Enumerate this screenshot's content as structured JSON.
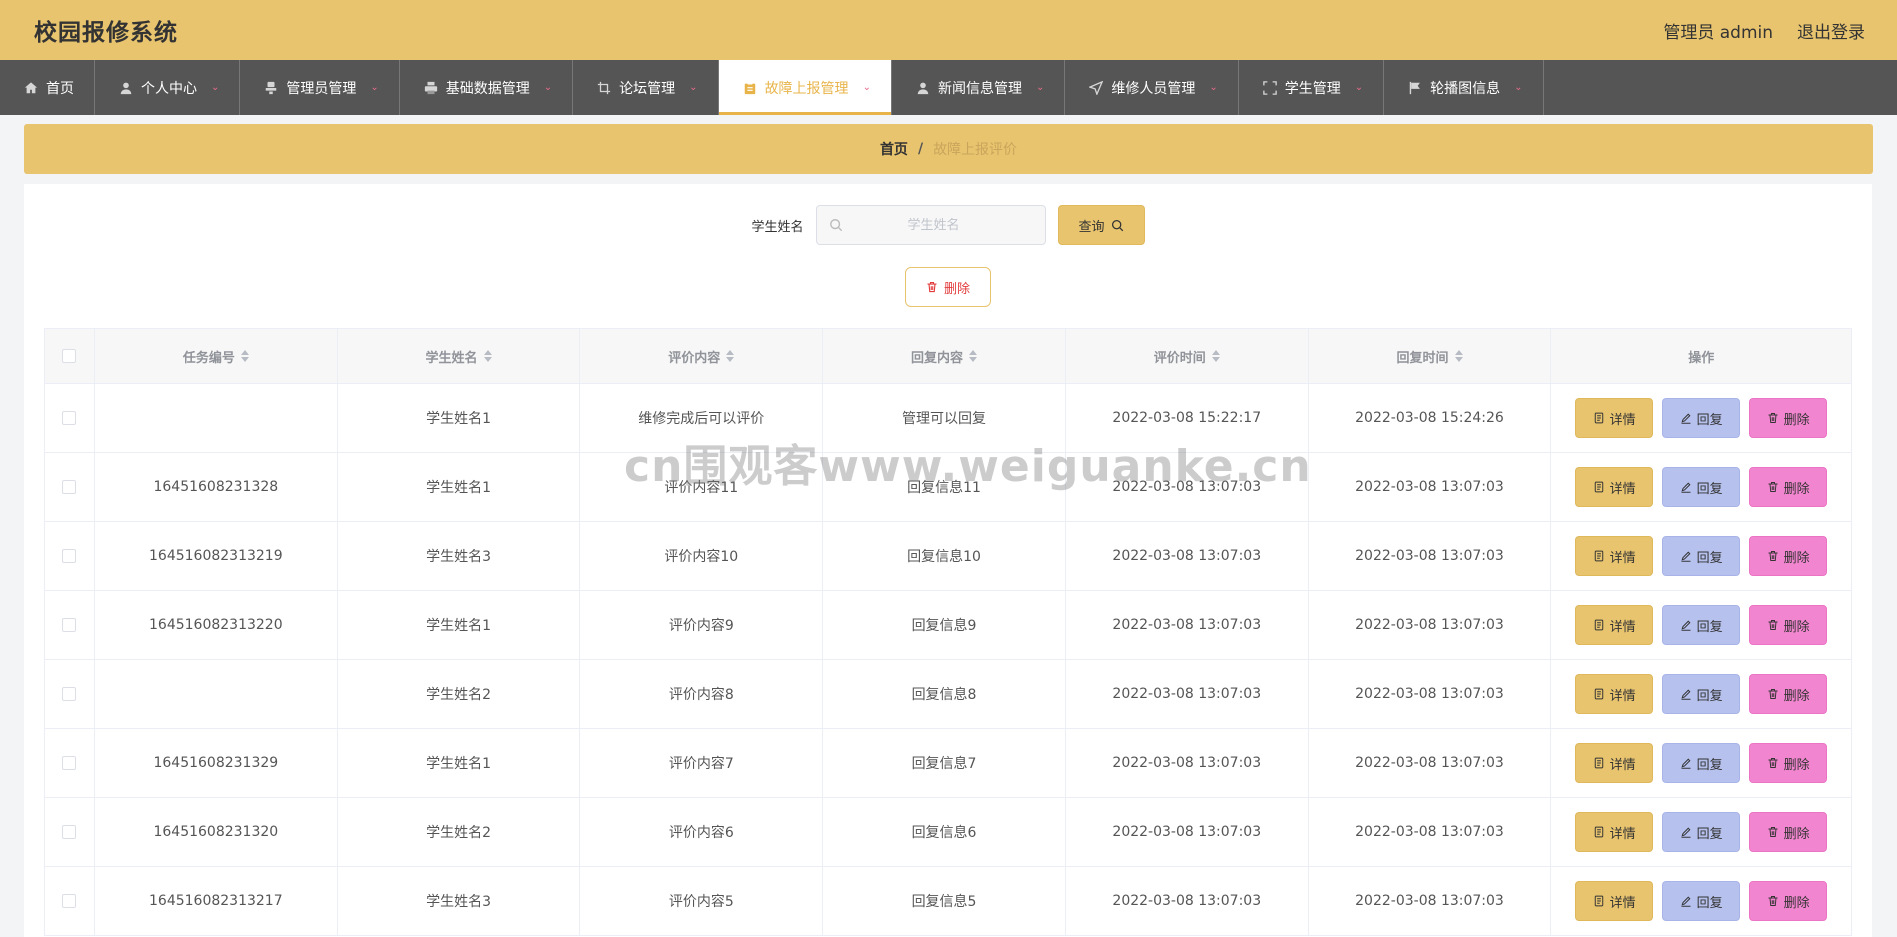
{
  "header": {
    "title": "校园报修系统",
    "user_label": "管理员 admin",
    "logout_label": "退出登录"
  },
  "nav": [
    {
      "label": "首页",
      "icon": "home-icon",
      "has_dropdown": false,
      "active": false
    },
    {
      "label": "个人中心",
      "icon": "user-icon",
      "has_dropdown": true,
      "active": false
    },
    {
      "label": "管理员管理",
      "icon": "stamp-icon",
      "has_dropdown": true,
      "active": false
    },
    {
      "label": "基础数据管理",
      "icon": "printer-icon",
      "has_dropdown": true,
      "active": false
    },
    {
      "label": "论坛管理",
      "icon": "crop-icon",
      "has_dropdown": true,
      "active": false
    },
    {
      "label": "故障上报管理",
      "icon": "clipboard-icon",
      "has_dropdown": true,
      "active": true
    },
    {
      "label": "新闻信息管理",
      "icon": "user-icon",
      "has_dropdown": true,
      "active": false
    },
    {
      "label": "维修人员管理",
      "icon": "send-icon",
      "has_dropdown": true,
      "active": false
    },
    {
      "label": "学生管理",
      "icon": "fullscreen-icon",
      "has_dropdown": true,
      "active": false
    },
    {
      "label": "轮播图信息",
      "icon": "flag-icon",
      "has_dropdown": true,
      "active": false
    }
  ],
  "breadcrumb": {
    "home": "首页",
    "separator": "/",
    "current": "故障上报评价"
  },
  "search": {
    "label": "学生姓名",
    "placeholder": "学生姓名",
    "value": "",
    "button_label": "查询"
  },
  "toolbar": {
    "delete_label": "删除"
  },
  "table": {
    "columns": [
      "任务编号",
      "学生姓名",
      "评价内容",
      "回复内容",
      "评价时间",
      "回复时间",
      "操作"
    ],
    "sortable": [
      true,
      true,
      true,
      true,
      true,
      true,
      false
    ],
    "row_actions": {
      "detail": "详情",
      "reply": "回复",
      "delete": "删除"
    },
    "rows": [
      {
        "task_no": "",
        "student": "学生姓名1",
        "comment": "维修完成后可以评价",
        "reply": "管理可以回复",
        "comment_time": "2022-03-08 15:22:17",
        "reply_time": "2022-03-08 15:24:26"
      },
      {
        "task_no": "16451608231328",
        "student": "学生姓名1",
        "comment": "评价内容11",
        "reply": "回复信息11",
        "comment_time": "2022-03-08 13:07:03",
        "reply_time": "2022-03-08 13:07:03"
      },
      {
        "task_no": "164516082313219",
        "student": "学生姓名3",
        "comment": "评价内容10",
        "reply": "回复信息10",
        "comment_time": "2022-03-08 13:07:03",
        "reply_time": "2022-03-08 13:07:03"
      },
      {
        "task_no": "164516082313220",
        "student": "学生姓名1",
        "comment": "评价内容9",
        "reply": "回复信息9",
        "comment_time": "2022-03-08 13:07:03",
        "reply_time": "2022-03-08 13:07:03"
      },
      {
        "task_no": "",
        "student": "学生姓名2",
        "comment": "评价内容8",
        "reply": "回复信息8",
        "comment_time": "2022-03-08 13:07:03",
        "reply_time": "2022-03-08 13:07:03"
      },
      {
        "task_no": "16451608231329",
        "student": "学生姓名1",
        "comment": "评价内容7",
        "reply": "回复信息7",
        "comment_time": "2022-03-08 13:07:03",
        "reply_time": "2022-03-08 13:07:03"
      },
      {
        "task_no": "16451608231320",
        "student": "学生姓名2",
        "comment": "评价内容6",
        "reply": "回复信息6",
        "comment_time": "2022-03-08 13:07:03",
        "reply_time": "2022-03-08 13:07:03"
      },
      {
        "task_no": "164516082313217",
        "student": "学生姓名3",
        "comment": "评价内容5",
        "reply": "回复信息5",
        "comment_time": "2022-03-08 13:07:03",
        "reply_time": "2022-03-08 13:07:03"
      }
    ]
  },
  "watermark": "cn围观客www.weiguanke.cn",
  "colors": {
    "accent": "#e8c46f",
    "nav_bg": "#555555",
    "reply_button": "#b6c1ee",
    "delete_button": "#f285cf",
    "danger_text": "#e23b3b"
  }
}
